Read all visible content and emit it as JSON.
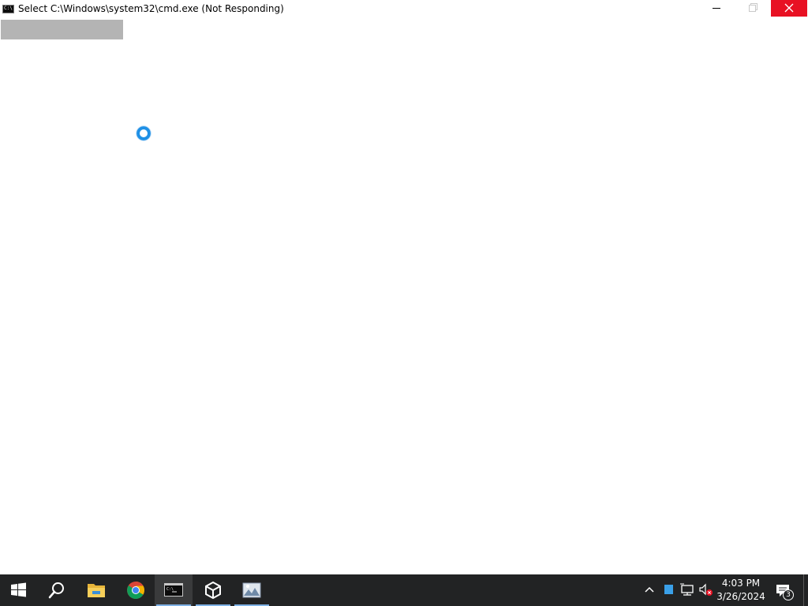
{
  "window": {
    "title": "Select C:\\Windows\\system32\\cmd.exe (Not Responding)",
    "icon": "cmd-icon",
    "icon_text": "C:\\",
    "controls": {
      "minimize": "minimize-icon",
      "maximize": "maximize-icon",
      "close": "close-icon",
      "close_color": "#e81123"
    }
  },
  "content": {
    "cursor_state": "busy",
    "cursor_color": "#1e90e6"
  },
  "taskbar": {
    "background": "#222324",
    "start": "windows-logo-icon",
    "search": "search-icon",
    "apps": [
      {
        "name": "File Explorer",
        "icon": "folder-icon",
        "active": false,
        "running": false
      },
      {
        "name": "Google Chrome",
        "icon": "chrome-icon",
        "active": false,
        "running": false
      },
      {
        "name": "Command Prompt",
        "icon": "cmd-icon",
        "active": true,
        "running": true
      },
      {
        "name": "Unity",
        "icon": "unity-icon",
        "active": false,
        "running": true
      },
      {
        "name": "Image app",
        "icon": "picture-icon",
        "active": false,
        "running": true
      }
    ],
    "tray": {
      "icons": [
        "chevron-up-icon",
        "blue-square-icon",
        "network-icon",
        "volume-muted-icon"
      ],
      "time": "4:03 PM",
      "date": "3/26/2024",
      "notification_count": "3"
    }
  }
}
